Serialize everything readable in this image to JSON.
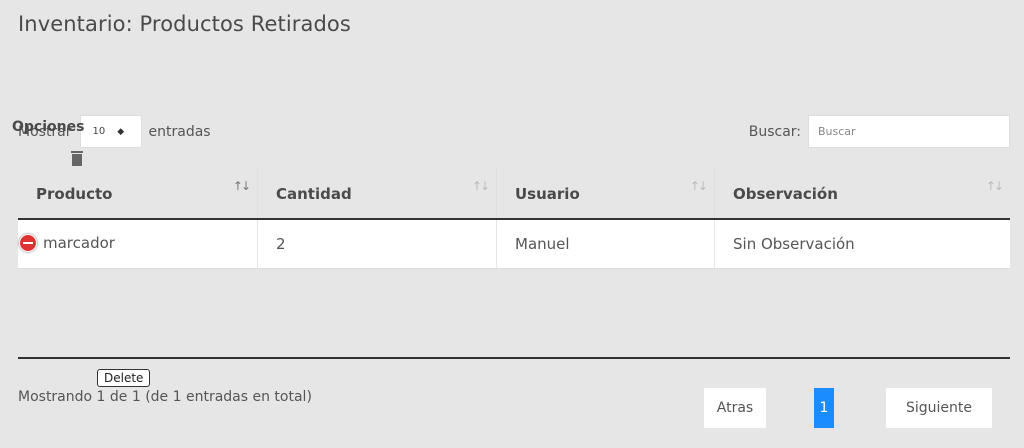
{
  "title": "Inventario: Productos Retirados",
  "length": {
    "prefix": "Mostrar",
    "value": "10",
    "suffix": "entradas"
  },
  "search": {
    "label": "Buscar:",
    "placeholder": "Buscar"
  },
  "table": {
    "columns": [
      "Producto",
      "Cantidad",
      "Usuario",
      "Observación"
    ],
    "sort_icon": "↑↓",
    "rows": [
      {
        "producto": "marcador",
        "cantidad": "2",
        "usuario": "Manuel",
        "observacion": "Sin Observación"
      }
    ],
    "child": {
      "label": "Opciones",
      "icon": "trash-icon"
    }
  },
  "tooltip": "Delete",
  "info": "Mostrando 1 de 1 (de 1 entradas en total)",
  "pagination": {
    "prev": "Atras",
    "current": "1",
    "next": "Siguiente"
  },
  "colors": {
    "background": "#e6e6e6",
    "accent": "#1a8cff"
  }
}
